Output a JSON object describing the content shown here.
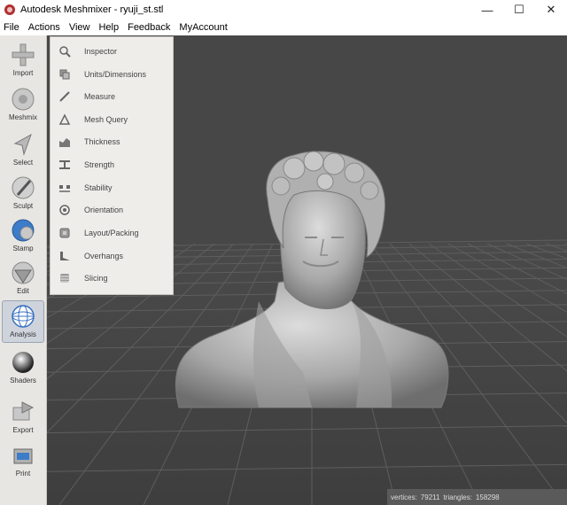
{
  "window": {
    "title": "Autodesk Meshmixer - ryuji_st.stl",
    "minimize": "—",
    "maximize": "☐",
    "close": "✕"
  },
  "menu": [
    "File",
    "Actions",
    "View",
    "Help",
    "Feedback",
    "MyAccount"
  ],
  "toolbar": [
    {
      "label": "Import",
      "icon": "plus-icon"
    },
    {
      "label": "Meshmix",
      "icon": "meshmix-icon"
    },
    {
      "label": "Select",
      "icon": "select-arrow-icon"
    },
    {
      "label": "Sculpt",
      "icon": "brush-icon"
    },
    {
      "label": "Stamp",
      "icon": "stamp-icon"
    },
    {
      "label": "Edit",
      "icon": "edit-icon"
    },
    {
      "label": "Analysis",
      "icon": "analysis-sphere-icon",
      "active": true
    },
    {
      "label": "Shaders",
      "icon": "shader-sphere-icon"
    },
    {
      "label": "Export",
      "icon": "export-icon"
    },
    {
      "label": "Print",
      "icon": "printer-icon"
    }
  ],
  "analysis_menu": [
    {
      "label": "Inspector",
      "icon": "magnifier-icon"
    },
    {
      "label": "Units/Dimensions",
      "icon": "units-icon"
    },
    {
      "label": "Measure",
      "icon": "measure-icon"
    },
    {
      "label": "Mesh Query",
      "icon": "mesh-query-icon"
    },
    {
      "label": "Thickness",
      "icon": "thickness-icon"
    },
    {
      "label": "Strength",
      "icon": "strength-icon"
    },
    {
      "label": "Stability",
      "icon": "stability-icon"
    },
    {
      "label": "Orientation",
      "icon": "orientation-icon"
    },
    {
      "label": "Layout/Packing",
      "icon": "layout-icon"
    },
    {
      "label": "Overhangs",
      "icon": "overhangs-icon"
    },
    {
      "label": "Slicing",
      "icon": "slicing-icon"
    }
  ],
  "status": {
    "vertices_label": "vertices:",
    "vertices": "79211",
    "triangles_label": "triangles:",
    "triangles": "158298"
  },
  "colors": {
    "viewport": "#4a4a4a",
    "grid": "#5c5c5c",
    "mesh": "#b8b8b8",
    "toolbar": "#e8e6e2"
  }
}
